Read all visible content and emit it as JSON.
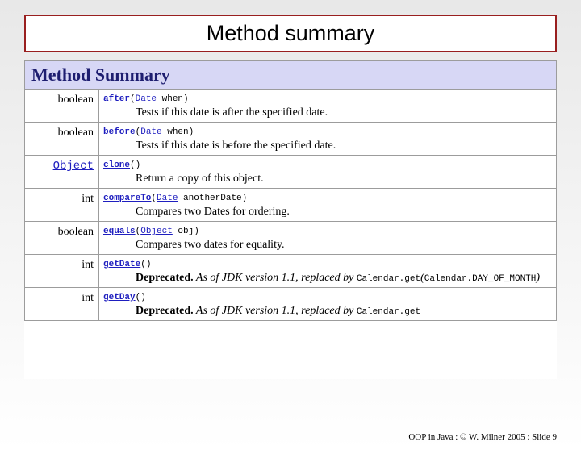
{
  "slide": {
    "title": "Method summary",
    "footer": "OOP in Java : © W. Milner 2005 : Slide 9"
  },
  "table": {
    "header": "Method Summary",
    "rows": [
      {
        "return_plain": "boolean",
        "return_link": "",
        "name": "after",
        "sig_open": "(",
        "param_type": "Date",
        "sig_rest": " when)",
        "desc": "Tests if this date is after the specified date.",
        "deprecated": false
      },
      {
        "return_plain": "boolean",
        "return_link": "",
        "name": "before",
        "sig_open": "(",
        "param_type": "Date",
        "sig_rest": " when)",
        "desc": "Tests if this date is before the specified date.",
        "deprecated": false
      },
      {
        "return_plain": "",
        "return_link": "Object",
        "name": "clone",
        "sig_open": "()",
        "param_type": "",
        "sig_rest": "",
        "desc": "Return a copy of this object.",
        "deprecated": false
      },
      {
        "return_plain": "int",
        "return_link": "",
        "name": "compareTo",
        "sig_open": "(",
        "param_type": "Date",
        "sig_rest": " anotherDate)",
        "desc": "Compares two Dates for ordering.",
        "deprecated": false
      },
      {
        "return_plain": "boolean",
        "return_link": "",
        "name": "equals",
        "sig_open": "(",
        "param_type": "Object",
        "sig_rest": " obj)",
        "desc": "Compares two dates for equality.",
        "deprecated": false
      },
      {
        "return_plain": "int",
        "return_link": "",
        "name": "getDate",
        "sig_open": "()",
        "param_type": "",
        "sig_rest": "",
        "desc": "",
        "deprecated": true,
        "dep_label": "Deprecated.",
        "dep_text": " As of JDK version 1.1, replaced by ",
        "dep_code1": "Calendar.get",
        "dep_text2": "(",
        "dep_code2": "Calendar.DAY_OF_MONTH",
        "dep_text3": ")"
      },
      {
        "return_plain": "int",
        "return_link": "",
        "name": "getDay",
        "sig_open": "()",
        "param_type": "",
        "sig_rest": "",
        "desc": "",
        "deprecated": true,
        "dep_label": "Deprecated.",
        "dep_text": " As of JDK version 1.1, replaced by ",
        "dep_code1": "Calendar.get",
        "dep_text2": "",
        "dep_code2": "",
        "dep_text3": ""
      }
    ]
  }
}
